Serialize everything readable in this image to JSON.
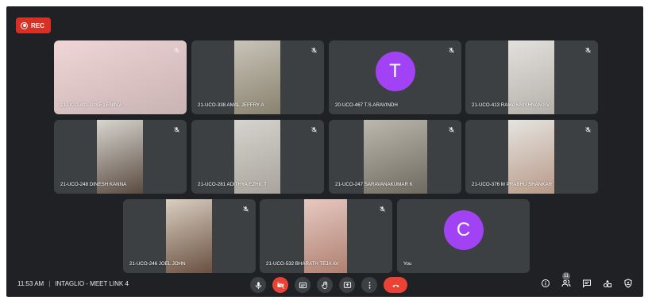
{
  "recording": {
    "label": "REC",
    "color": "#d93025"
  },
  "participants": [
    {
      "name": "21-UCO-411 JOSE LENIN A",
      "type": "video",
      "palette": [
        "#f0d6d6",
        "#c9b2b2"
      ]
    },
    {
      "name": "21-UCO-338 AMAL JEFFRY A",
      "type": "video",
      "palette": [
        "#c8c4b8",
        "#8a8270"
      ]
    },
    {
      "name": "20-UCO-467 T.S.ARAVINDH",
      "type": "avatar",
      "initial": "T",
      "avatar_color": "#a142f4"
    },
    {
      "name": "21-UCO-413 RAMA KRISHNAN SV",
      "type": "video",
      "palette": [
        "#e3e1dd",
        "#b5b1aa"
      ]
    },
    {
      "name": "21-UCO-248 DINESH KANNA",
      "type": "video",
      "palette": [
        "#d8d6d0",
        "#5a4a40"
      ]
    },
    {
      "name": "21-UCO-281 ADITHYA EZHIL T",
      "type": "video",
      "palette": [
        "#d6d4ce",
        "#a8a49c"
      ]
    },
    {
      "name": "21-UCO-247 SARAVANAKUMAR K",
      "type": "video",
      "palette": [
        "#bdb8ad",
        "#6e6a60"
      ]
    },
    {
      "name": "21-UCO-376 M PRABHU SHANKAR",
      "type": "video",
      "palette": [
        "#e6e4e0",
        "#b89a88"
      ]
    },
    {
      "name": "21-UCO-246 JOEL JOHN",
      "type": "video",
      "palette": [
        "#d9cfc2",
        "#6a5040"
      ]
    },
    {
      "name": "21-UCO-532 BHARATH TEJA AV",
      "type": "video",
      "palette": [
        "#e6c9c2",
        "#b08070"
      ]
    },
    {
      "name": "You",
      "type": "avatar",
      "initial": "C",
      "avatar_color": "#a142f4"
    }
  ],
  "meeting": {
    "time": "11:53 AM",
    "separator": "|",
    "title": "INTAGLIO - MEET LINK 4"
  },
  "controls": [
    {
      "icon": "microphone-icon"
    },
    {
      "icon": "camera-off-icon"
    },
    {
      "icon": "captions-icon"
    },
    {
      "icon": "raise-hand-icon"
    },
    {
      "icon": "present-screen-icon"
    },
    {
      "icon": "more-options-icon"
    },
    {
      "icon": "end-call-icon"
    }
  ],
  "side_panel": {
    "participant_count": "11"
  }
}
